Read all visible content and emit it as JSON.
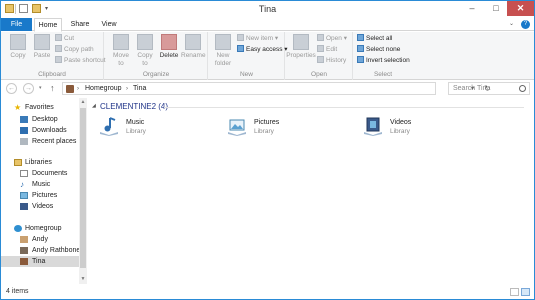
{
  "window": {
    "title": "Tina"
  },
  "tabs": {
    "file": "File",
    "home": "Home",
    "share": "Share",
    "view": "View"
  },
  "ribbon": {
    "clipboard": {
      "label": "Clipboard",
      "copy": "Copy",
      "paste": "Paste",
      "cut": "Cut",
      "copy_path": "Copy path",
      "paste_shortcut": "Paste shortcut"
    },
    "organize": {
      "label": "Organize",
      "move_to": "Move to",
      "copy_to": "Copy to",
      "delete": "Delete",
      "rename": "Rename"
    },
    "new": {
      "label": "New",
      "new_folder": "New folder",
      "new_item": "New item",
      "easy_access": "Easy access"
    },
    "open": {
      "label": "Open",
      "properties": "Properties",
      "open": "Open",
      "edit": "Edit",
      "history": "History"
    },
    "select": {
      "label": "Select",
      "select_all": "Select all",
      "select_none": "Select none",
      "invert_selection": "Invert selection"
    }
  },
  "address": {
    "breadcrumbs": [
      "Homegroup",
      "Tina"
    ],
    "search_placeholder": "Search Tina"
  },
  "nav": {
    "favorites": {
      "label": "Favorites",
      "items": [
        "Desktop",
        "Downloads",
        "Recent places"
      ]
    },
    "libraries": {
      "label": "Libraries",
      "items": [
        "Documents",
        "Music",
        "Pictures",
        "Videos"
      ]
    },
    "homegroup": {
      "label": "Homegroup",
      "items": [
        "Andy",
        "Andy Rathbone",
        "Tina"
      ]
    }
  },
  "content": {
    "group_header": "CLEMENTINE2 (4)",
    "items": [
      {
        "name": "Music",
        "type": "Library"
      },
      {
        "name": "Pictures",
        "type": "Library"
      },
      {
        "name": "Videos",
        "type": "Library"
      }
    ]
  },
  "status": {
    "items_count": "4 items"
  },
  "colors": {
    "accent": "#1979ca",
    "header_text": "#1e3287",
    "selected_nav": "#d9d9d9"
  }
}
